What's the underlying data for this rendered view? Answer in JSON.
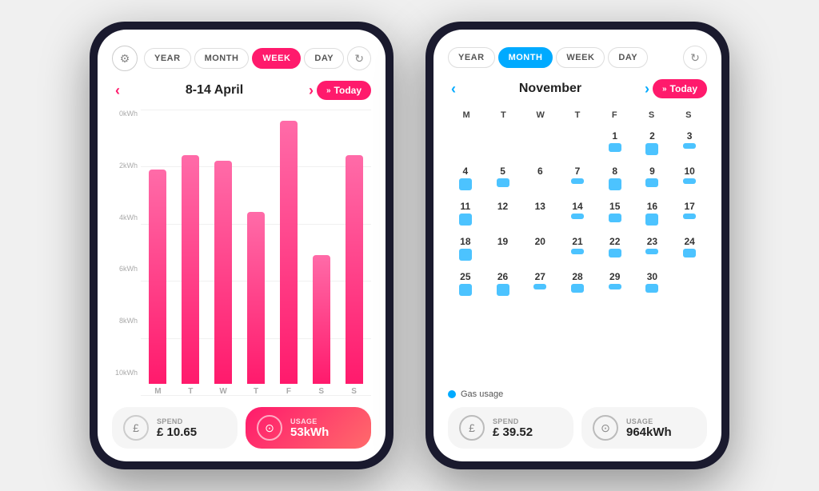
{
  "phone1": {
    "tabs": [
      "YEAR",
      "MONTH",
      "WEEK",
      "DAY"
    ],
    "active_tab": "WEEK",
    "date_label": "8-14 April",
    "today_label": "Today",
    "y_labels": [
      "0kWh",
      "2kWh",
      "4kWh",
      "6kWh",
      "8kWh",
      "10kWh"
    ],
    "bars": [
      {
        "day": "M",
        "height_pct": 75
      },
      {
        "day": "T",
        "height_pct": 80
      },
      {
        "day": "W",
        "height_pct": 78
      },
      {
        "day": "T",
        "height_pct": 60
      },
      {
        "day": "F",
        "height_pct": 92
      },
      {
        "day": "S",
        "height_pct": 45
      },
      {
        "day": "S",
        "height_pct": 80
      }
    ],
    "spend_label": "Spend",
    "spend_value": "£ 10.65",
    "usage_label": "Usage",
    "usage_value": "53kWh"
  },
  "phone2": {
    "tabs": [
      "YEAR",
      "MONTH",
      "WEEK",
      "DAY"
    ],
    "active_tab": "MONTH",
    "date_label": "November",
    "today_label": "Today",
    "day_headers": [
      "M",
      "T",
      "W",
      "T",
      "F",
      "S",
      "S"
    ],
    "weeks": [
      [
        {
          "num": "",
          "bar": "none"
        },
        {
          "num": "",
          "bar": "none"
        },
        {
          "num": "",
          "bar": "none"
        },
        {
          "num": "",
          "bar": "none"
        },
        {
          "num": "1",
          "bar": "mid"
        },
        {
          "num": "2",
          "bar": "tall"
        },
        {
          "num": "3",
          "bar": "short"
        },
        {
          "num": "4",
          "bar": "tall"
        },
        {
          "num": "5",
          "bar": "mid"
        }
      ],
      [
        {
          "num": "6",
          "bar": "none"
        },
        {
          "num": "7",
          "bar": "short"
        },
        {
          "num": "8",
          "bar": "tall"
        },
        {
          "num": "9",
          "bar": "mid"
        },
        {
          "num": "10",
          "bar": "short"
        },
        {
          "num": "11",
          "bar": "tall"
        },
        {
          "num": "12",
          "bar": "none"
        }
      ],
      [
        {
          "num": "13",
          "bar": "none"
        },
        {
          "num": "14",
          "bar": "short"
        },
        {
          "num": "15",
          "bar": "mid"
        },
        {
          "num": "16",
          "bar": "tall"
        },
        {
          "num": "17",
          "bar": "short"
        },
        {
          "num": "18",
          "bar": "tall"
        },
        {
          "num": "19",
          "bar": "none"
        }
      ],
      [
        {
          "num": "20",
          "bar": "none"
        },
        {
          "num": "21",
          "bar": "short"
        },
        {
          "num": "22",
          "bar": "mid"
        },
        {
          "num": "23",
          "bar": "short"
        },
        {
          "num": "24",
          "bar": "mid"
        },
        {
          "num": "25",
          "bar": "tall"
        },
        {
          "num": "26",
          "bar": "tall"
        }
      ],
      [
        {
          "num": "27",
          "bar": "short"
        },
        {
          "num": "28",
          "bar": "mid"
        },
        {
          "num": "29",
          "bar": "short"
        },
        {
          "num": "30",
          "bar": "mid"
        },
        {
          "num": "",
          "bar": "none"
        },
        {
          "num": "",
          "bar": "none"
        },
        {
          "num": "",
          "bar": "none"
        }
      ]
    ],
    "legend_text": "Gas usage",
    "spend_label": "Spend",
    "spend_value": "£ 39.52",
    "usage_label": "Usage",
    "usage_value": "964kWh"
  }
}
